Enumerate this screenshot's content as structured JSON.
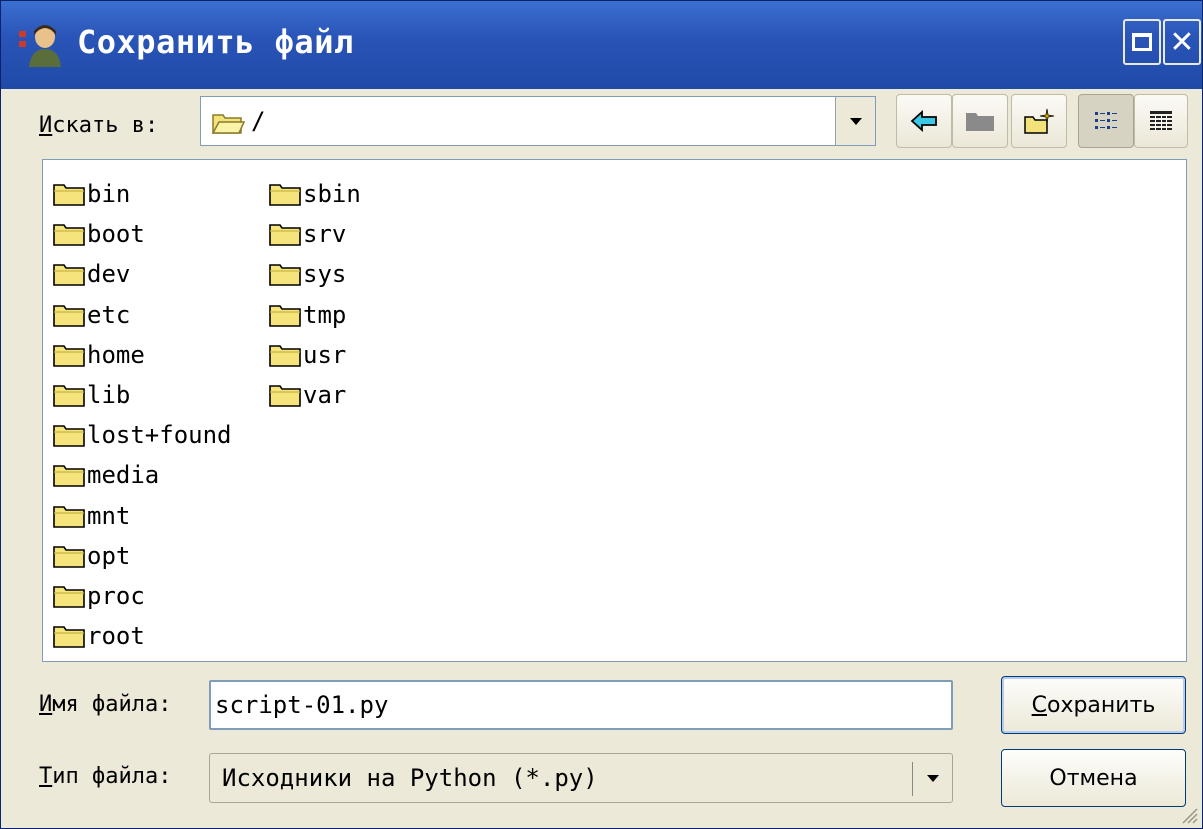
{
  "window": {
    "title": "Сохранить файл",
    "titlebar_color": "#2a55b8"
  },
  "lookin": {
    "label_underline": "И",
    "label_rest": "скать в:",
    "value": "/"
  },
  "toolbar": {
    "icons": [
      "back-arrow-icon",
      "parent-folder-icon",
      "new-folder-icon",
      "list-view-icon",
      "detail-view-icon"
    ]
  },
  "files": {
    "column1": [
      "bin",
      "boot",
      "dev",
      "etc",
      "home",
      "lib",
      "lost+found",
      "media",
      "mnt",
      "opt",
      "proc",
      "root"
    ],
    "column2": [
      "sbin",
      "srv",
      "sys",
      "tmp",
      "usr",
      "var"
    ]
  },
  "filename": {
    "label_underline": "И",
    "label_rest": "мя файла:",
    "value": "script-01.py"
  },
  "filetype": {
    "label_underline": "Т",
    "label_rest": "ип файла:",
    "value": "Исходники на Python (*.py)"
  },
  "buttons": {
    "save_underline": "С",
    "save_rest": "охранить",
    "cancel": "Отмена"
  }
}
